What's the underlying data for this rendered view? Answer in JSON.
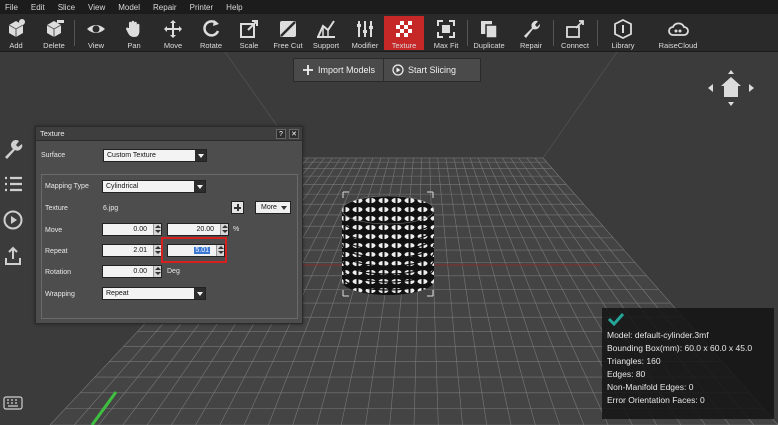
{
  "menu": [
    "File",
    "Edit",
    "Slice",
    "View",
    "Model",
    "Repair",
    "Printer",
    "Help"
  ],
  "toolbar": [
    {
      "label": "Add",
      "icon": "cube-add-icon"
    },
    {
      "label": "Delete",
      "icon": "cube-delete-icon"
    },
    {
      "label": "View",
      "icon": "eye-icon"
    },
    {
      "label": "Pan",
      "icon": "hand-icon"
    },
    {
      "label": "Move",
      "icon": "move-arrows-icon"
    },
    {
      "label": "Rotate",
      "icon": "rotate-icon"
    },
    {
      "label": "Scale",
      "icon": "scale-icon"
    },
    {
      "label": "Free Cut",
      "icon": "free-cut-icon"
    },
    {
      "label": "Support",
      "icon": "support-icon"
    },
    {
      "label": "Modifier",
      "icon": "modifier-sliders-icon"
    },
    {
      "label": "Texture",
      "icon": "texture-checker-icon",
      "active": true
    },
    {
      "label": "Max Fit",
      "icon": "max-fit-icon"
    },
    {
      "label": "Duplicate",
      "icon": "duplicate-icon"
    },
    {
      "label": "Repair",
      "icon": "wrench-icon"
    },
    {
      "label": "Connect",
      "icon": "connect-icon"
    },
    {
      "label": "Library",
      "icon": "library-icon"
    },
    {
      "label": "RaiseCloud",
      "icon": "cloud-icon"
    }
  ],
  "actions": {
    "import": "Import Models",
    "slice": "Start Slicing"
  },
  "panel": {
    "title": "Texture",
    "help": "?",
    "close": "✕",
    "surface_label": "Surface",
    "surface_value": "Custom Texture",
    "mapping_label": "Mapping Type",
    "mapping_value": "Cylindrical",
    "texture_label": "Texture",
    "texture_value": "6.jpg",
    "more_label": "More",
    "move_label": "Move",
    "move_x": "0.00",
    "move_y": "20.00",
    "move_unit": "%",
    "repeat_label": "Repeat",
    "repeat_x": "2.01",
    "repeat_y": "5.01",
    "rotation_label": "Rotation",
    "rotation_value": "0.00",
    "rotation_unit": "Deg",
    "wrapping_label": "Wrapping",
    "wrapping_value": "Repeat"
  },
  "info": {
    "model": "Model: default-cylinder.3mf",
    "bbox": "Bounding Box(mm): 60.0 x 60.0 x 45.0",
    "triangles": "Triangles: 160",
    "edges": "Edges: 80",
    "non_manifold": "Non-Manifold Edges: 0",
    "error_faces": "Error Orientation Faces: 0"
  },
  "colors": {
    "accent": "#c62828",
    "selection": "#3a76d2",
    "check": "#26a69a"
  }
}
